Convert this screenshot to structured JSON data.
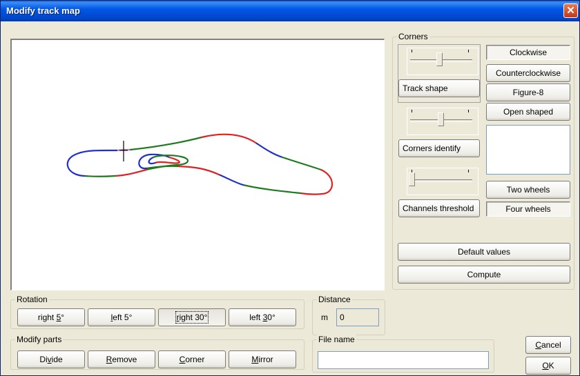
{
  "window": {
    "title": "Modify track map",
    "close_glyph": "✕"
  },
  "corners": {
    "group_label": "Corners",
    "track_shape_label": "Track shape",
    "corners_identify_label": "Corners identify",
    "channels_threshold_label": "Channels threshold",
    "direction_options": [
      "Clockwise",
      "Counterclockwise",
      "Figure-8",
      "Open shaped"
    ],
    "selected_direction": "Clockwise",
    "wheels_options": [
      "Two wheels",
      "Four wheels"
    ],
    "selected_wheels": "Four wheels",
    "default_values_label": "Default values",
    "compute_label": "Compute"
  },
  "rotation": {
    "group_label": "Rotation",
    "right5": {
      "pre": "right ",
      "key": "5",
      "post": "°"
    },
    "left5": {
      "pre": "",
      "key": "l",
      "post": "eft 5°"
    },
    "right30": {
      "pre": "",
      "key": "r",
      "post": "ight 30°"
    },
    "left30": {
      "pre": "left ",
      "key": "3",
      "post": "0°"
    }
  },
  "modify_parts": {
    "group_label": "Modify parts",
    "divide": {
      "pre": "Di",
      "key": "v",
      "post": "ide"
    },
    "remove": {
      "pre": "",
      "key": "R",
      "post": "emove"
    },
    "corner": {
      "pre": "",
      "key": "C",
      "post": "orner"
    },
    "mirror": {
      "pre": "",
      "key": "M",
      "post": "irror"
    }
  },
  "distance": {
    "group_label": "Distance",
    "unit": "m",
    "value": "0"
  },
  "file_name": {
    "group_label": "File name",
    "value": ""
  },
  "dialog_buttons": {
    "cancel": {
      "key": "C",
      "post": "ancel"
    },
    "ok": {
      "key": "O",
      "post": "K"
    }
  },
  "colors": {
    "straight": "#1e7a1e",
    "corner_right": "#e02020",
    "corner_left": "#1f2fcf",
    "selected_segment": "#d070d0"
  }
}
